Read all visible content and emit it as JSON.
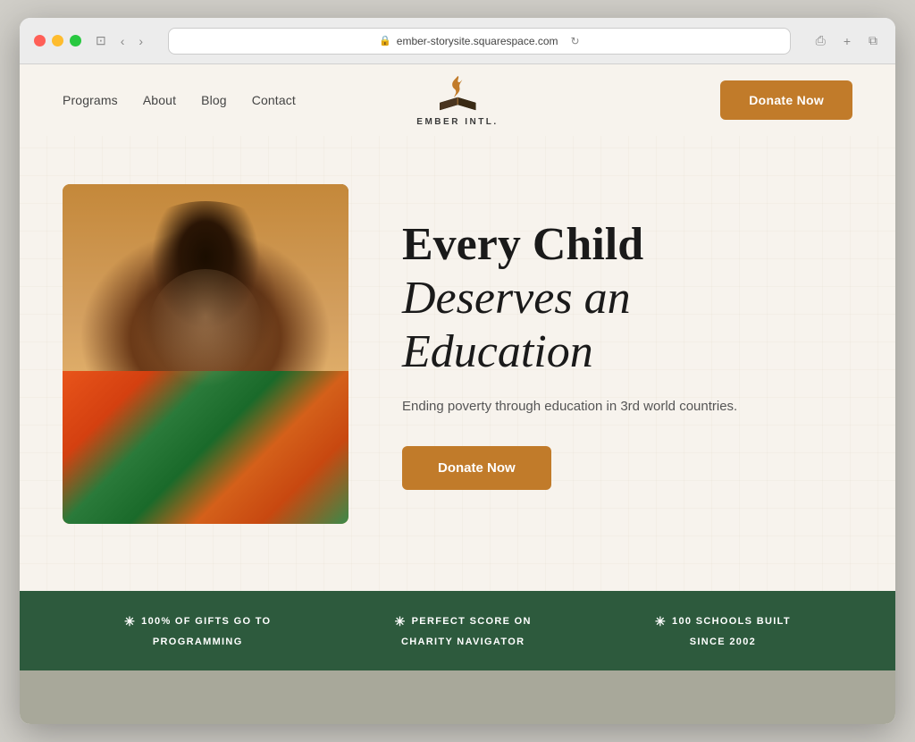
{
  "browser": {
    "url": "ember-storysite.squarespace.com",
    "reload_label": "⟳"
  },
  "nav": {
    "links": [
      {
        "label": "Programs",
        "id": "programs"
      },
      {
        "label": "About",
        "id": "about"
      },
      {
        "label": "Blog",
        "id": "blog"
      },
      {
        "label": "Contact",
        "id": "contact"
      }
    ]
  },
  "logo": {
    "name": "EMBER INTL."
  },
  "header": {
    "donate_label": "Donate Now"
  },
  "hero": {
    "title_line1": "Every Child",
    "title_line2": "Deserves an",
    "title_line3": "Education",
    "subtitle": "Ending poverty through education in 3rd world countries.",
    "donate_label": "Donate Now"
  },
  "stats": [
    {
      "icon": "✳",
      "line1": "100% OF GIFTS GO TO",
      "line2": "PROGRAMMING"
    },
    {
      "icon": "✳",
      "line1": "PERFECT SCORE ON",
      "line2": "CHARITY NAVIGATOR"
    },
    {
      "icon": "✳",
      "line1": "100 SCHOOLS BUILT",
      "line2": "SINCE 2002"
    }
  ],
  "colors": {
    "donate_btn": "#c17b2a",
    "stats_bg": "#2d5a3d",
    "site_bg": "#f7f3ed"
  }
}
